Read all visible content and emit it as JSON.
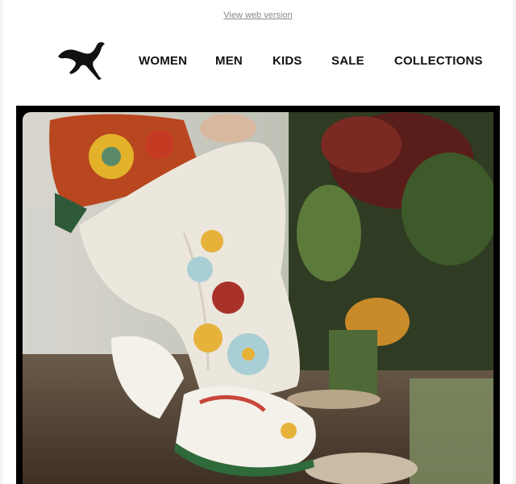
{
  "preheader": {
    "view_web_label": "View web version"
  },
  "brand": {
    "logo_icon": "puma-cat-logo-icon"
  },
  "nav": {
    "items": [
      {
        "label": "WOMEN"
      },
      {
        "label": "MEN"
      },
      {
        "label": "KIDS"
      },
      {
        "label": "SALE"
      },
      {
        "label": "COLLECTIONS"
      }
    ]
  },
  "colors": {
    "text": "#111111",
    "muted_link": "#8a8a8a",
    "hero_frame": "#000000"
  }
}
